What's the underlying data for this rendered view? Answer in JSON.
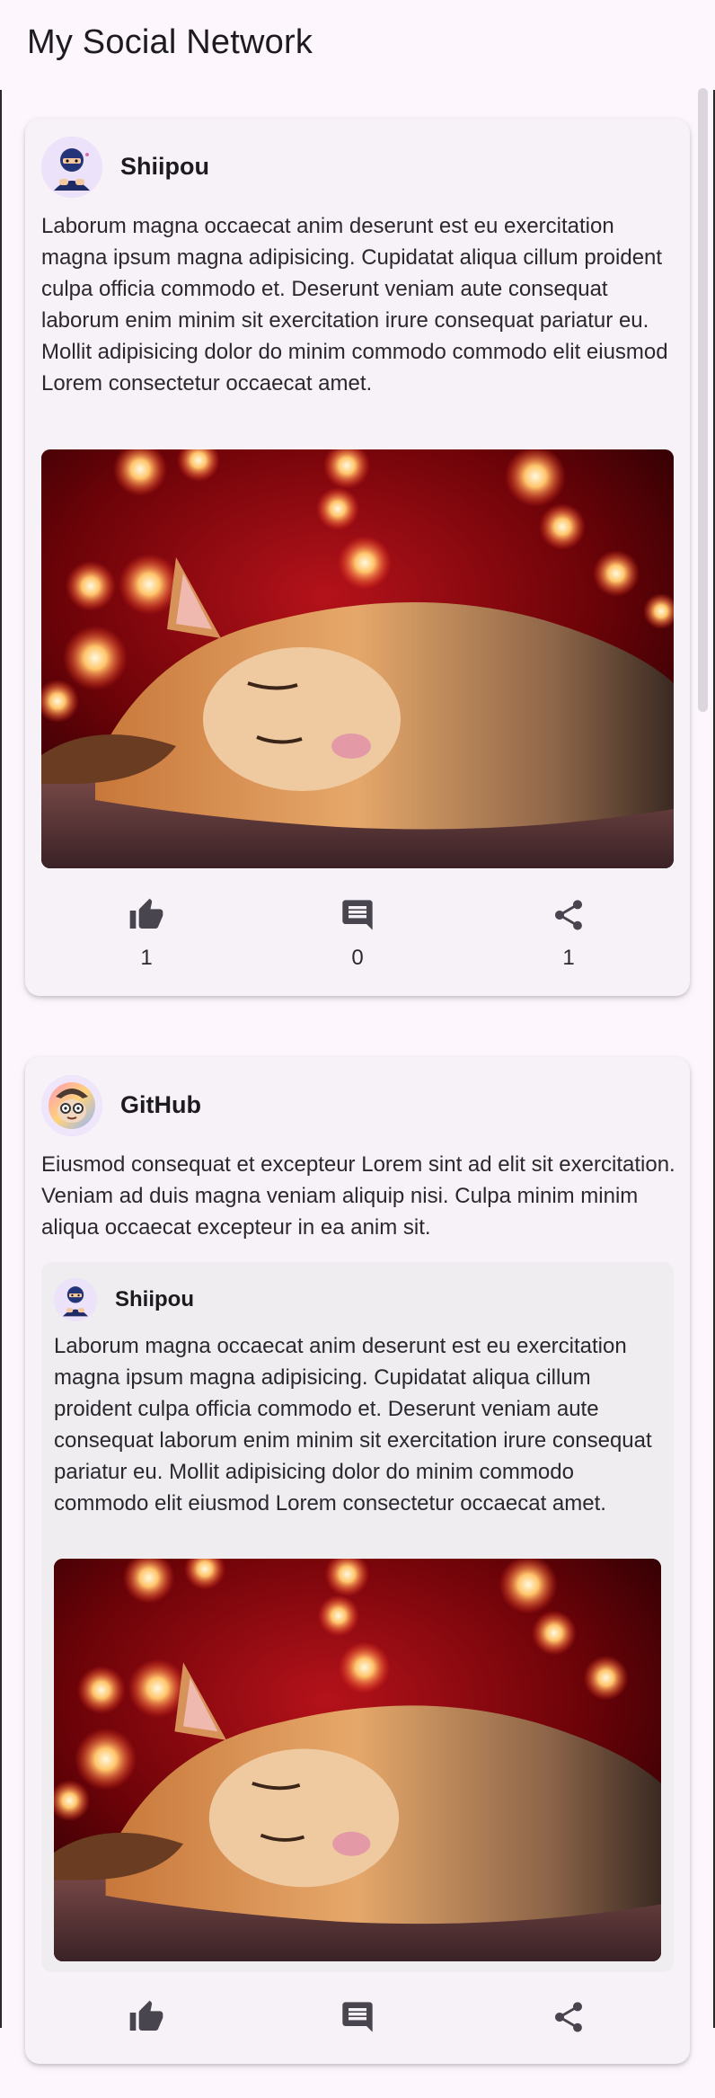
{
  "app": {
    "title": "My Social Network"
  },
  "posts": [
    {
      "author": "Shiipou",
      "avatar": "ninja-avatar",
      "text": "Laborum magna occaecat anim deserunt est eu exercitation magna ipsum magna adipisicing. Cupidatat aliqua cillum proident culpa officia commodo et. Deserunt veniam aute consequat laborum enim minim sit exercitation irure consequat pariatur eu. Mollit adipisicing dolor do minim commodo commodo elit eiusmod Lorem consectetur occaecat amet.",
      "image": "sleeping-orange-cat-with-red-bokeh-lights",
      "likes": "1",
      "comments": "0",
      "shares": "1"
    },
    {
      "author": "GitHub",
      "avatar": "octocat-avatar",
      "text": "Eiusmod consequat et excepteur Lorem sint ad elit sit exercitation. Veniam ad duis magna veniam aliquip nisi. Culpa minim minim aliqua occaecat excepteur in ea anim sit.",
      "quoted": {
        "author": "Shiipou",
        "avatar": "ninja-avatar",
        "text": "Laborum magna occaecat anim deserunt est eu exercitation magna ipsum magna adipisicing. Cupidatat aliqua cillum proident culpa officia commodo et. Deserunt veniam aute consequat laborum enim minim sit exercitation irure consequat pariatur eu. Mollit adipisicing dolor do minim commodo commodo elit eiusmod Lorem consectetur occaecat amet.",
        "image": "sleeping-orange-cat-with-red-bokeh-lights"
      }
    }
  ],
  "icons": {
    "like": "thumb-up-icon",
    "comment": "comment-icon",
    "share": "share-icon"
  },
  "colors": {
    "background": "#fdf7fd",
    "card": "#f7f1f8",
    "quote": "#efedef",
    "icon": "#49454f"
  }
}
